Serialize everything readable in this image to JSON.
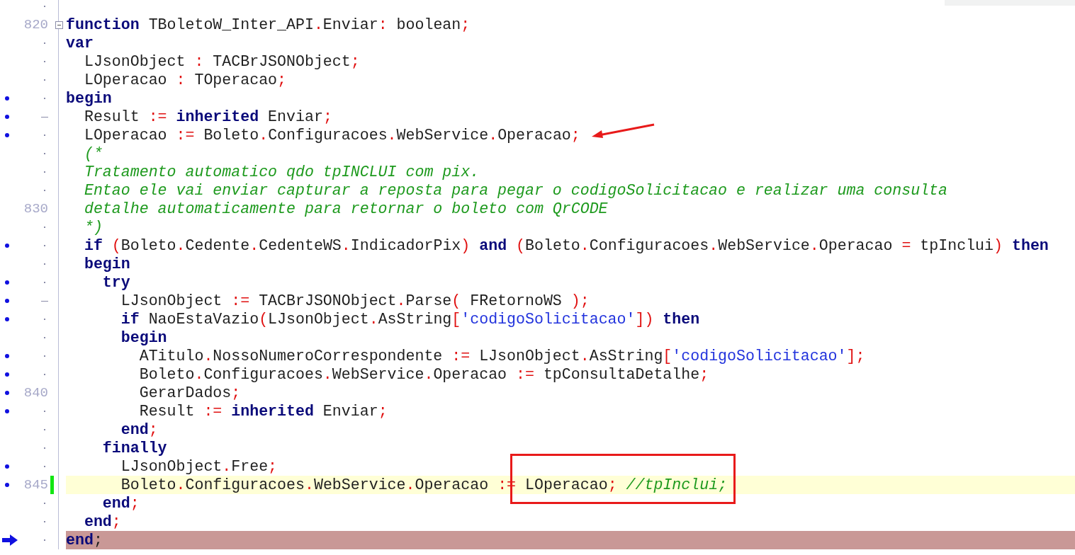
{
  "lines": [
    {
      "gutter": {
        "kind": "dot"
      },
      "executable": false,
      "modified": false
    },
    {
      "gutter": {
        "kind": "number",
        "text": "820"
      },
      "expanded": true,
      "executable": false,
      "modified": false,
      "code": [
        {
          "kind": "kw",
          "text": "function"
        },
        {
          "kind": "id",
          "text": " TBoletoW_Inter_API"
        },
        {
          "kind": "sym",
          "text": "."
        },
        {
          "kind": "id",
          "text": "Enviar"
        },
        {
          "kind": "sym",
          "text": ":"
        },
        {
          "kind": "id",
          "text": " boolean"
        },
        {
          "kind": "sym",
          "text": ";"
        }
      ]
    },
    {
      "gutter": {
        "kind": "dot"
      },
      "executable": false,
      "modified": false,
      "code": [
        {
          "kind": "kw",
          "text": "var"
        }
      ]
    },
    {
      "gutter": {
        "kind": "dot"
      },
      "executable": false,
      "modified": false,
      "code": [
        {
          "kind": "id",
          "text": "  LJsonObject "
        },
        {
          "kind": "sym",
          "text": ":"
        },
        {
          "kind": "id",
          "text": " TACBrJSONObject"
        },
        {
          "kind": "sym",
          "text": ";"
        }
      ]
    },
    {
      "gutter": {
        "kind": "dot"
      },
      "executable": false,
      "modified": false,
      "code": [
        {
          "kind": "id",
          "text": "  LOperacao "
        },
        {
          "kind": "sym",
          "text": ":"
        },
        {
          "kind": "id",
          "text": " TOperacao"
        },
        {
          "kind": "sym",
          "text": ";"
        }
      ]
    },
    {
      "gutter": {
        "kind": "dot"
      },
      "executable": true,
      "modified": false,
      "code": [
        {
          "kind": "kw",
          "text": "begin"
        }
      ]
    },
    {
      "gutter": {
        "kind": "dash"
      },
      "executable": true,
      "modified": false,
      "code": [
        {
          "kind": "id",
          "text": "  Result "
        },
        {
          "kind": "sym",
          "text": ":="
        },
        {
          "kind": "kw",
          "text": " inherited"
        },
        {
          "kind": "id",
          "text": " Enviar"
        },
        {
          "kind": "sym",
          "text": ";"
        }
      ]
    },
    {
      "gutter": {
        "kind": "dot"
      },
      "executable": true,
      "modified": false,
      "code": [
        {
          "kind": "id",
          "text": "  LOperacao "
        },
        {
          "kind": "sym",
          "text": ":="
        },
        {
          "kind": "id",
          "text": " Boleto"
        },
        {
          "kind": "sym",
          "text": "."
        },
        {
          "kind": "id",
          "text": "Configuracoes"
        },
        {
          "kind": "sym",
          "text": "."
        },
        {
          "kind": "id",
          "text": "WebService"
        },
        {
          "kind": "sym",
          "text": "."
        },
        {
          "kind": "id",
          "text": "Operacao"
        },
        {
          "kind": "sym",
          "text": ";"
        }
      ]
    },
    {
      "gutter": {
        "kind": "dot"
      },
      "executable": false,
      "modified": false,
      "code": [
        {
          "kind": "comment",
          "text": "  (*"
        }
      ]
    },
    {
      "gutter": {
        "kind": "dot"
      },
      "executable": false,
      "modified": false,
      "code": [
        {
          "kind": "comment",
          "text": "  Tratamento automatico qdo tpINCLUI com pix."
        }
      ]
    },
    {
      "gutter": {
        "kind": "dot"
      },
      "executable": false,
      "modified": false,
      "code": [
        {
          "kind": "comment",
          "text": "  Entao ele vai enviar capturar a reposta para pegar o codigoSolicitacao e realizar uma consulta"
        }
      ]
    },
    {
      "gutter": {
        "kind": "number",
        "text": "830"
      },
      "executable": false,
      "modified": false,
      "code": [
        {
          "kind": "comment",
          "text": "  detalhe automaticamente para retornar o boleto com QrCODE"
        }
      ]
    },
    {
      "gutter": {
        "kind": "dot"
      },
      "executable": false,
      "modified": false,
      "code": [
        {
          "kind": "comment",
          "text": "  *)"
        }
      ]
    },
    {
      "gutter": {
        "kind": "dot"
      },
      "executable": true,
      "modified": false,
      "code": [
        {
          "kind": "kw",
          "text": "  if"
        },
        {
          "kind": "sym",
          "text": " ("
        },
        {
          "kind": "id",
          "text": "Boleto"
        },
        {
          "kind": "sym",
          "text": "."
        },
        {
          "kind": "id",
          "text": "Cedente"
        },
        {
          "kind": "sym",
          "text": "."
        },
        {
          "kind": "id",
          "text": "CedenteWS"
        },
        {
          "kind": "sym",
          "text": "."
        },
        {
          "kind": "id",
          "text": "IndicadorPix"
        },
        {
          "kind": "sym",
          "text": ")"
        },
        {
          "kind": "kw",
          "text": " and"
        },
        {
          "kind": "sym",
          "text": " ("
        },
        {
          "kind": "id",
          "text": "Boleto"
        },
        {
          "kind": "sym",
          "text": "."
        },
        {
          "kind": "id",
          "text": "Configuracoes"
        },
        {
          "kind": "sym",
          "text": "."
        },
        {
          "kind": "id",
          "text": "WebService"
        },
        {
          "kind": "sym",
          "text": "."
        },
        {
          "kind": "id",
          "text": "Operacao "
        },
        {
          "kind": "sym",
          "text": "="
        },
        {
          "kind": "id",
          "text": " tpInclui"
        },
        {
          "kind": "sym",
          "text": ")"
        },
        {
          "kind": "kw",
          "text": " then"
        }
      ]
    },
    {
      "gutter": {
        "kind": "dot"
      },
      "executable": false,
      "modified": false,
      "code": [
        {
          "kind": "kw",
          "text": "  begin"
        }
      ]
    },
    {
      "gutter": {
        "kind": "dot"
      },
      "executable": true,
      "modified": false,
      "code": [
        {
          "kind": "kw",
          "text": "    try"
        }
      ]
    },
    {
      "gutter": {
        "kind": "dash"
      },
      "executable": true,
      "modified": false,
      "code": [
        {
          "kind": "id",
          "text": "      LJsonObject "
        },
        {
          "kind": "sym",
          "text": ":="
        },
        {
          "kind": "id",
          "text": " TACBrJSONObject"
        },
        {
          "kind": "sym",
          "text": "."
        },
        {
          "kind": "id",
          "text": "Parse"
        },
        {
          "kind": "sym",
          "text": "("
        },
        {
          "kind": "id",
          "text": " FRetornoWS "
        },
        {
          "kind": "sym",
          "text": ")"
        },
        {
          "kind": "sym",
          "text": ";"
        }
      ]
    },
    {
      "gutter": {
        "kind": "dot"
      },
      "executable": true,
      "modified": false,
      "code": [
        {
          "kind": "kw",
          "text": "      if"
        },
        {
          "kind": "id",
          "text": " NaoEstaVazio"
        },
        {
          "kind": "sym",
          "text": "("
        },
        {
          "kind": "id",
          "text": "LJsonObject"
        },
        {
          "kind": "sym",
          "text": "."
        },
        {
          "kind": "id",
          "text": "AsString"
        },
        {
          "kind": "sym",
          "text": "["
        },
        {
          "kind": "str",
          "text": "'codigoSolicitacao'"
        },
        {
          "kind": "sym",
          "text": "])"
        },
        {
          "kind": "kw",
          "text": " then"
        }
      ]
    },
    {
      "gutter": {
        "kind": "dot"
      },
      "executable": false,
      "modified": false,
      "code": [
        {
          "kind": "kw",
          "text": "      begin"
        }
      ]
    },
    {
      "gutter": {
        "kind": "dot"
      },
      "executable": true,
      "modified": false,
      "code": [
        {
          "kind": "id",
          "text": "        ATitulo"
        },
        {
          "kind": "sym",
          "text": "."
        },
        {
          "kind": "id",
          "text": "NossoNumeroCorrespondente "
        },
        {
          "kind": "sym",
          "text": ":="
        },
        {
          "kind": "id",
          "text": " LJsonObject"
        },
        {
          "kind": "sym",
          "text": "."
        },
        {
          "kind": "id",
          "text": "AsString"
        },
        {
          "kind": "sym",
          "text": "["
        },
        {
          "kind": "str",
          "text": "'codigoSolicitacao'"
        },
        {
          "kind": "sym",
          "text": "];"
        }
      ]
    },
    {
      "gutter": {
        "kind": "dot"
      },
      "executable": true,
      "modified": false,
      "code": [
        {
          "kind": "id",
          "text": "        Boleto"
        },
        {
          "kind": "sym",
          "text": "."
        },
        {
          "kind": "id",
          "text": "Configuracoes"
        },
        {
          "kind": "sym",
          "text": "."
        },
        {
          "kind": "id",
          "text": "WebService"
        },
        {
          "kind": "sym",
          "text": "."
        },
        {
          "kind": "id",
          "text": "Operacao "
        },
        {
          "kind": "sym",
          "text": ":="
        },
        {
          "kind": "id",
          "text": " tpConsultaDetalhe"
        },
        {
          "kind": "sym",
          "text": ";"
        }
      ]
    },
    {
      "gutter": {
        "kind": "number",
        "text": "840"
      },
      "executable": true,
      "modified": false,
      "code": [
        {
          "kind": "id",
          "text": "        GerarDados"
        },
        {
          "kind": "sym",
          "text": ";"
        }
      ]
    },
    {
      "gutter": {
        "kind": "dot"
      },
      "executable": true,
      "modified": false,
      "code": [
        {
          "kind": "id",
          "text": "        Result "
        },
        {
          "kind": "sym",
          "text": ":="
        },
        {
          "kind": "kw",
          "text": " inherited"
        },
        {
          "kind": "id",
          "text": " Enviar"
        },
        {
          "kind": "sym",
          "text": ";"
        }
      ]
    },
    {
      "gutter": {
        "kind": "dot"
      },
      "executable": false,
      "modified": false,
      "code": [
        {
          "kind": "kw",
          "text": "      end"
        },
        {
          "kind": "sym",
          "text": ";"
        }
      ]
    },
    {
      "gutter": {
        "kind": "dot"
      },
      "executable": false,
      "modified": false,
      "code": [
        {
          "kind": "kw",
          "text": "    finally"
        }
      ]
    },
    {
      "gutter": {
        "kind": "dot"
      },
      "executable": true,
      "modified": false,
      "code": [
        {
          "kind": "id",
          "text": "      LJsonObject"
        },
        {
          "kind": "sym",
          "text": "."
        },
        {
          "kind": "id",
          "text": "Free"
        },
        {
          "kind": "sym",
          "text": ";"
        }
      ]
    },
    {
      "gutter": {
        "kind": "number",
        "text": "845"
      },
      "executable": true,
      "modified": true,
      "current": true,
      "code": [
        {
          "kind": "id",
          "text": "      Boleto"
        },
        {
          "kind": "sym",
          "text": "."
        },
        {
          "kind": "id",
          "text": "Configuracoes"
        },
        {
          "kind": "sym",
          "text": "."
        },
        {
          "kind": "id",
          "text": "WebService"
        },
        {
          "kind": "sym",
          "text": "."
        },
        {
          "kind": "id",
          "text": "Operacao "
        },
        {
          "kind": "sym",
          "text": ":="
        },
        {
          "kind": "id",
          "text": " LOperacao"
        },
        {
          "kind": "sym",
          "text": ";"
        },
        {
          "kind": "comment",
          "text": " //tpInclui;"
        }
      ]
    },
    {
      "gutter": {
        "kind": "dot"
      },
      "executable": false,
      "modified": false,
      "code": [
        {
          "kind": "kw",
          "text": "    end"
        },
        {
          "kind": "sym",
          "text": ";"
        }
      ]
    },
    {
      "gutter": {
        "kind": "dot"
      },
      "executable": false,
      "modified": false,
      "code": [
        {
          "kind": "kw",
          "text": "  end"
        },
        {
          "kind": "sym",
          "text": ";"
        }
      ]
    },
    {
      "gutter": {
        "kind": "dot"
      },
      "executable": false,
      "modified": false,
      "pointer": true,
      "execution": true,
      "code": [
        {
          "kind": "kw",
          "text": "end"
        },
        {
          "kind": "id",
          "text": ";"
        }
      ]
    }
  ]
}
